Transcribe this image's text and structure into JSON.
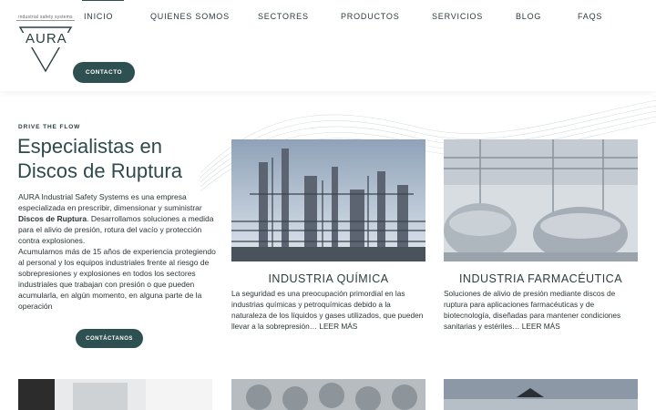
{
  "brand": {
    "name": "AURA",
    "tagline": "industrial safety systems"
  },
  "nav": {
    "items": [
      {
        "label": "INICIO",
        "active": true
      },
      {
        "label": "QUIENES SOMOS"
      },
      {
        "label": "SECTORES"
      },
      {
        "label": "PRODUCTOS"
      },
      {
        "label": "SERVICIOS"
      },
      {
        "label": "BLOG"
      },
      {
        "label": "FAQS"
      }
    ],
    "contact_button": "CONTACTO"
  },
  "hero": {
    "eyebrow": "DRIVE THE FLOW",
    "title": "Especialistas en Discos de Ruptura",
    "paragraph_1_pre": "AURA Industrial Safety Systems es una empresa especializada en prescribir, dimensionar y suministrar ",
    "paragraph_1_bold": "Discos de Ruptura",
    "paragraph_1_post": ". Desarrollamos soluciones a medida para el alivio de presión, rotura del vacío y protección contra explosiones.",
    "paragraph_2": "Acumulamos más de 15 años de experiencia protegiendo al personal y los equipos industriales frente al riesgo de sobrepresiones y explosiones en todos los sectores industriales que trabajan con presión o que pueden acumularla, en algún momento, en alguna parte de la operación",
    "cta": "CONTÁCTANOS"
  },
  "cards": [
    {
      "title": "INDUSTRIA QUÍMICA",
      "text": "La seguridad es una preocupación primordial en las industrias químicas y petroquímicas debido a la naturaleza de los líquidos y gases utilizados, que pueden llevar a la sobrepresión… LEER MÁS",
      "image": "chemical-plant-image"
    },
    {
      "title": "INDUSTRIA FARMACÉUTICA",
      "text": "Soluciones de alivio de presión mediante discos de ruptura para aplicaciones farmacéuticas y de biotecnología, diseñadas para mantener condiciones sanitarias y estériles… LEER MÁS",
      "image": "pharma-tanks-image"
    }
  ],
  "colors": {
    "primary": "#2e5051",
    "text": "#2b3d3e"
  }
}
